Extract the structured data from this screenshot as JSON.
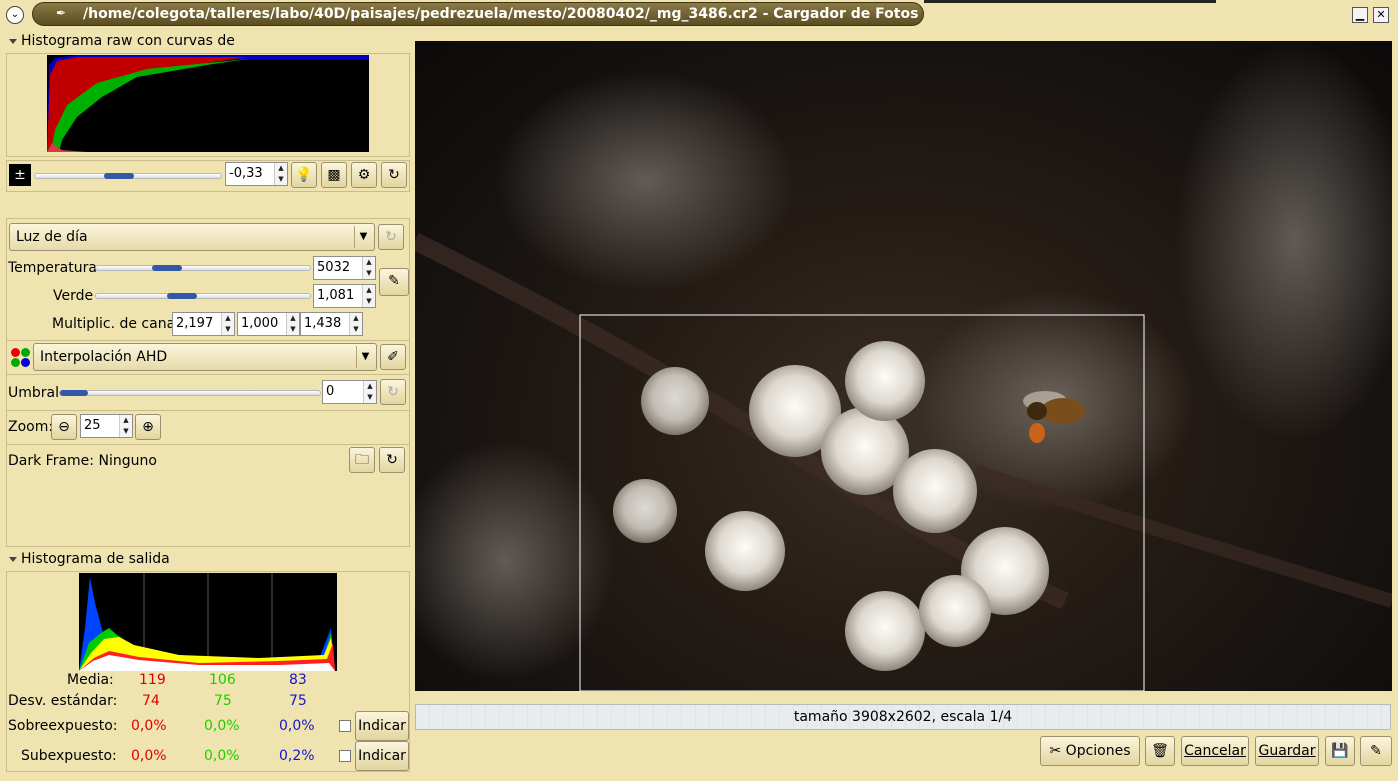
{
  "window": {
    "title": "/home/colegota/talleres/labo/40D/paisajes/pedrezuela/mesto/20080402/_mg_3486.cr2 - Cargador de Fotos UFRaw",
    "minimize_glyph": "▁",
    "close_glyph": "✕",
    "menu_glyph": "⌄"
  },
  "raw_histogram": {
    "header": "Histograma raw con curvas de conversion"
  },
  "exposure": {
    "value": "-0,33",
    "slider_fraction": 0.45
  },
  "tabs": [
    {
      "name": "white-balance-tab",
      "glyph": "⚖"
    },
    {
      "name": "base-curve-tab",
      "glyph": "▦"
    },
    {
      "name": "color-management-tab",
      "glyph": "◪"
    },
    {
      "name": "corrections-tab",
      "glyph": "✹"
    },
    {
      "name": "lens-tab",
      "glyph": "✎"
    },
    {
      "name": "exif-tab",
      "glyph": "▥"
    }
  ],
  "white_balance": {
    "preset": "Luz de día",
    "temperature_label": "Temperatura",
    "temperature_value": "5032",
    "temperature_fraction": 0.33,
    "green_label": "Verde",
    "green_value": "1,081",
    "green_fraction": 0.4,
    "channel_label": "Multiplic. de canal:",
    "channel_values": [
      "2,197",
      "1,000",
      "1,438"
    ]
  },
  "interpolation": {
    "selected": "Interpolación AHD"
  },
  "threshold": {
    "label": "Umbral",
    "value": "0",
    "fraction": 0.05
  },
  "zoom": {
    "label": "Zoom:",
    "value": "25"
  },
  "dark_frame": {
    "label": "Dark Frame:",
    "value": "Ninguno"
  },
  "output_histogram": {
    "header": "Histograma de salida",
    "rows": [
      {
        "label": "Media:",
        "r": "119",
        "g": "106",
        "b": "83"
      },
      {
        "label": "Desv. estándar:",
        "r": "74",
        "g": "75",
        "b": "75"
      }
    ],
    "overexposed": {
      "label": "Sobreexpuesto:",
      "r": "0,0%",
      "g": "0,0%",
      "b": "0,0%",
      "button": "Indicar"
    },
    "underexposed": {
      "label": "Subexpuesto:",
      "r": "0,0%",
      "g": "0,0%",
      "b": "0,2%",
      "button": "Indicar"
    }
  },
  "preview": {
    "status": "tamaño 3908x2602, escala 1/4"
  },
  "buttons": {
    "options": "Opciones",
    "cancel": "Cancelar",
    "save": "Guardar"
  },
  "colors": {
    "panel_bg": "#efe4b0",
    "red": "#e00000",
    "green": "#22cc00",
    "blue": "#1515c8"
  }
}
